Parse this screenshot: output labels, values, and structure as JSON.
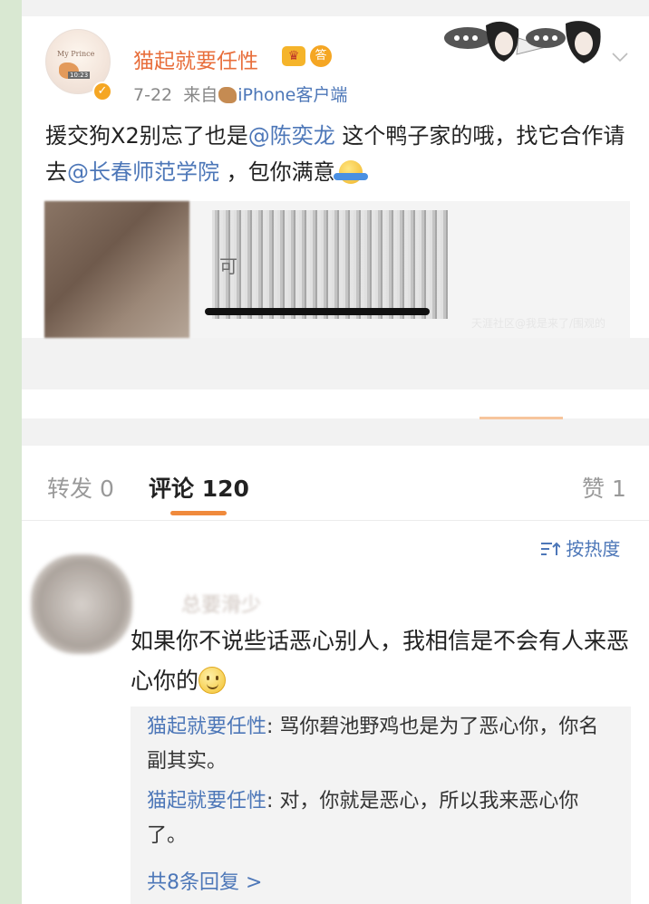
{
  "post": {
    "username": "猫起就要任性",
    "badges": {
      "crown_icon": "crown-icon",
      "answer_label": "答"
    },
    "date": "7-22",
    "source_prefix": "来自",
    "source_name": "iPhone客户端",
    "text": {
      "part1": "援交狗X2别忘了也是",
      "mention1": "@陈奕龙",
      "part2": " 这个鸭子家的哦，找它合作请去",
      "mention2": "@长春师范学院",
      "part3": " ，包你满意"
    },
    "image_text": "可",
    "watermark": "天涯社区@我是来了/围观的"
  },
  "tabs": {
    "forward": "转发 0",
    "comments": "评论 120",
    "likes": "赞 1"
  },
  "sort": {
    "label": "按热度",
    "icon": "sort-icon"
  },
  "comment": {
    "author": "总要滑少",
    "text": "如果你不说些话恶心别人，我相信是不会有人来恶心你的",
    "replies": [
      {
        "name": "猫起就要任性",
        "sep": ": ",
        "text": "骂你碧池野鸡也是为了恶心你，你名副其实。"
      },
      {
        "name": "猫起就要任性",
        "sep": ": ",
        "text": "对，你就是恶心，所以我来恶心你了。"
      }
    ],
    "more_replies": "共8条回复 >"
  },
  "colors": {
    "accent": "#f08a3c",
    "link": "#4d77b8",
    "username": "#e86f3c"
  }
}
